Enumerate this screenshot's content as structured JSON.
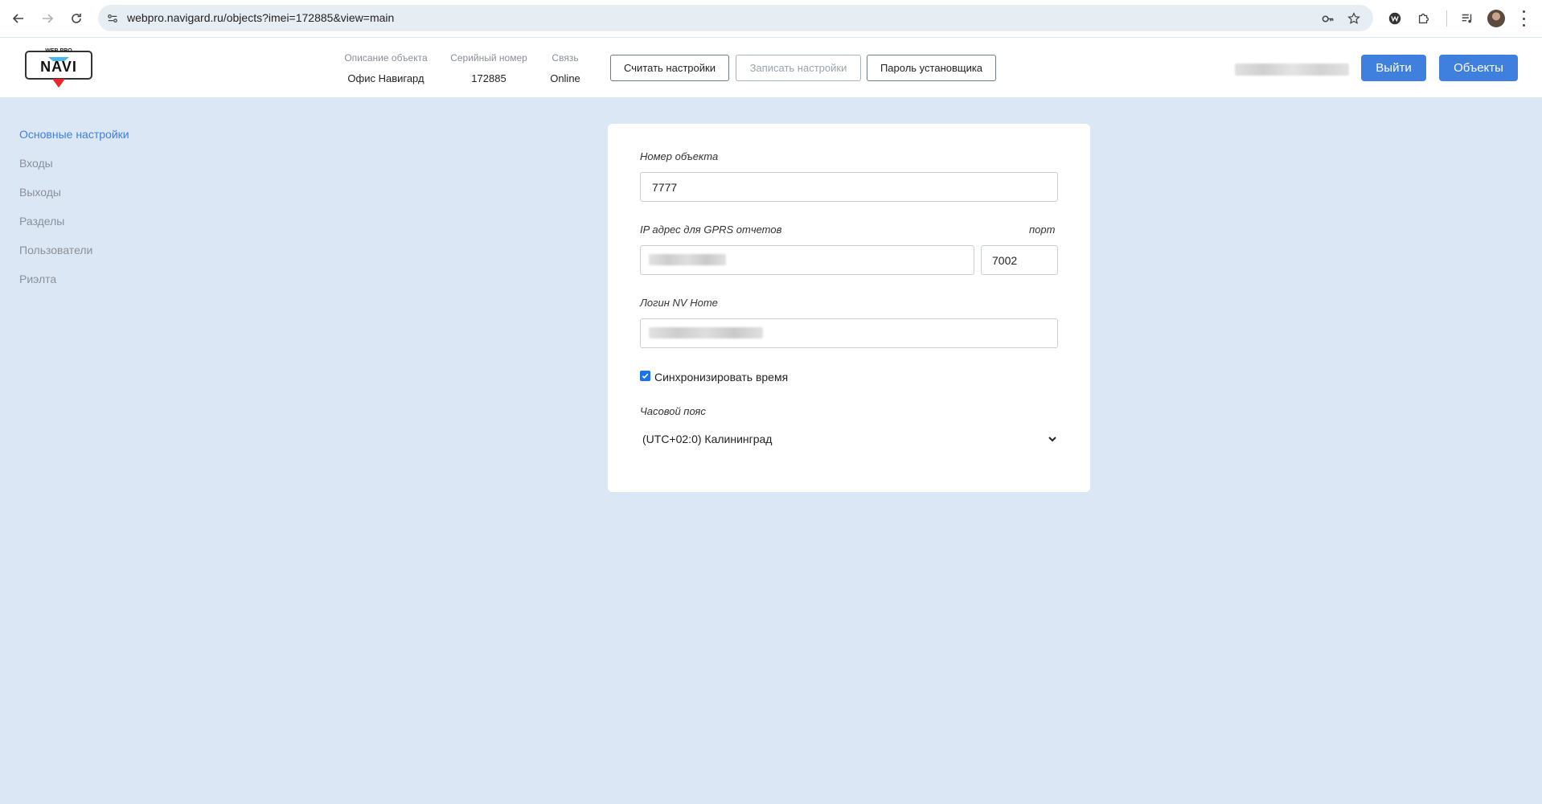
{
  "browser": {
    "url": "webpro.navigard.ru/objects?imei=172885&view=main"
  },
  "header": {
    "logo_top_text": "WEB PRO",
    "logo_text": "NAVI",
    "object_desc_label": "Описание объекта",
    "object_desc_value": "Офис Навигард",
    "serial_label": "Серийный номер",
    "serial_value": "172885",
    "connection_label": "Связь",
    "connection_value": "Online",
    "read_settings_label": "Считать настройки",
    "write_settings_label": "Записать настройки",
    "installer_password_label": "Пароль установщика",
    "logout_label": "Выйти",
    "objects_label": "Объекты"
  },
  "sidebar": {
    "items": [
      {
        "label": "Основные настройки",
        "active": true
      },
      {
        "label": "Входы",
        "active": false
      },
      {
        "label": "Выходы",
        "active": false
      },
      {
        "label": "Разделы",
        "active": false
      },
      {
        "label": "Пользователи",
        "active": false
      },
      {
        "label": "Риэлта",
        "active": false
      }
    ]
  },
  "form": {
    "object_number_label": "Номер объекта",
    "object_number_value": "7777",
    "ip_label": "IP адрес для GPRS отчетов",
    "port_label": "порт",
    "port_value": "7002",
    "login_label": "Логин NV Home",
    "sync_time_label": "Синхронизировать время",
    "sync_time_checked": true,
    "timezone_label": "Часовой пояс",
    "timezone_value": "(UTC+02:0) Калининград"
  },
  "colors": {
    "accent": "#3f7fde",
    "page_bg": "#dce7f5"
  }
}
